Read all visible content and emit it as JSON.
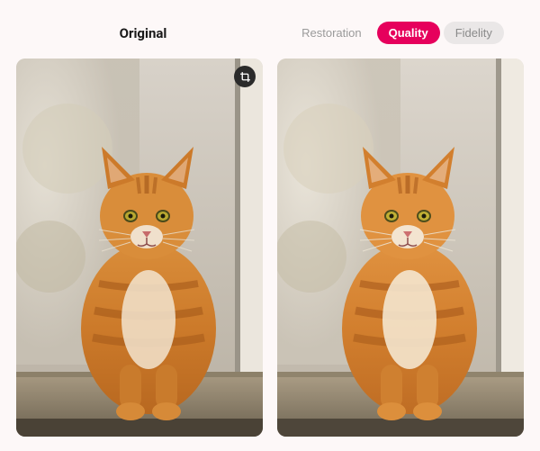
{
  "header": {
    "original_label": "Original"
  },
  "tabs": {
    "restoration": "Restoration",
    "quality": "Quality",
    "fidelity": "Fidelity",
    "active": "quality"
  },
  "icons": {
    "crop": "crop-icon"
  },
  "colors": {
    "accent": "#e6005c",
    "muted": "#9a9a9a",
    "tab_bg": "#eae7e7"
  },
  "images": {
    "subject": "orange-tabby-cat-on-windowsill"
  }
}
